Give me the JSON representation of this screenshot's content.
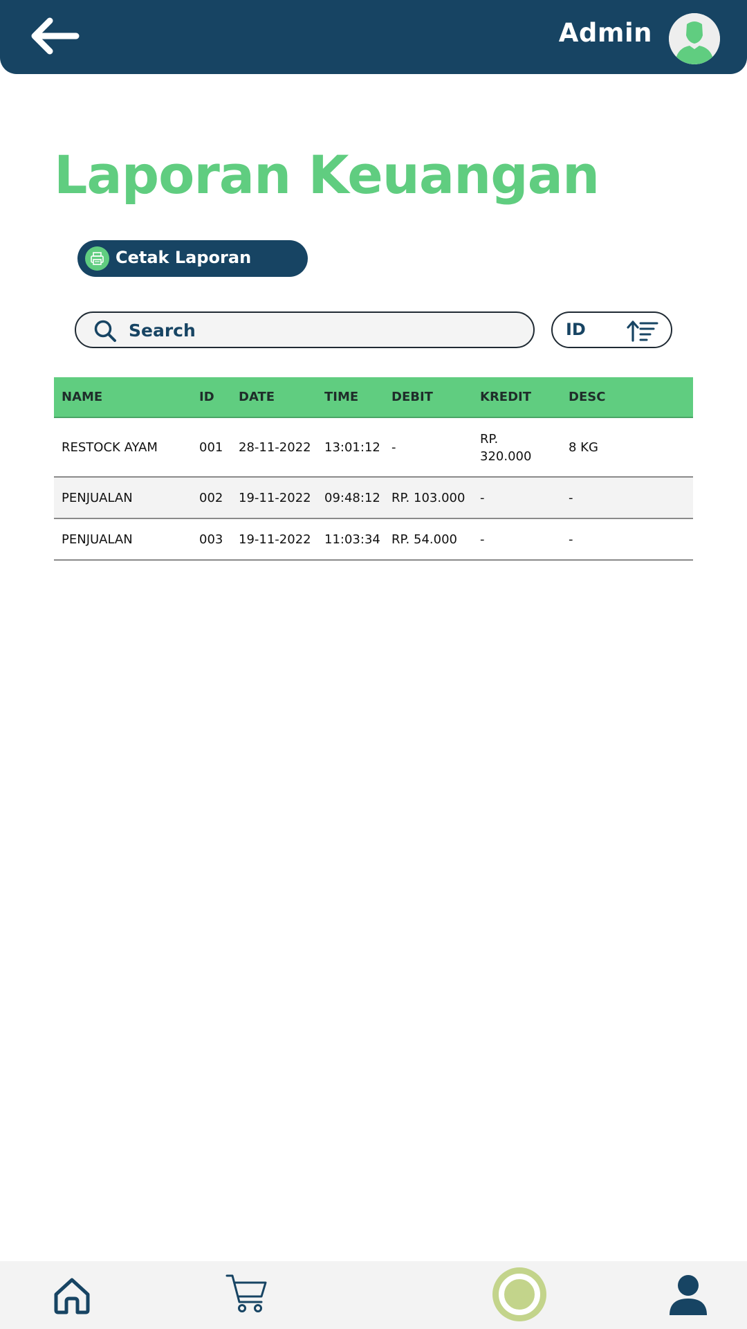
{
  "header": {
    "admin_name": "Admin",
    "colors": {
      "header_bg": "#174463",
      "accent": "#60cd80"
    }
  },
  "page": {
    "title": "Laporan Keuangan"
  },
  "actions": {
    "print_label": "Cetak Laporan"
  },
  "search": {
    "placeholder": "Search",
    "value": ""
  },
  "sort": {
    "label": "ID",
    "icon": "sort-ascending-icon"
  },
  "table": {
    "headers": [
      "NAME",
      "ID",
      "DATE",
      "TIME",
      "DEBIT",
      "KREDIT",
      "DESC"
    ],
    "rows": [
      {
        "name": "RESTOCK AYAM",
        "id": "001",
        "date": "28-11-2022",
        "time": "13:01:12",
        "debit": "-",
        "kredit": "RP. 320.000",
        "desc": "8 KG"
      },
      {
        "name": "PENJUALAN",
        "id": "002",
        "date": "19-11-2022",
        "time": "09:48:12",
        "debit": "RP. 103.000",
        "kredit": "-",
        "desc": "-"
      },
      {
        "name": "PENJUALAN",
        "id": "003",
        "date": "19-11-2022",
        "time": "11:03:34",
        "debit": "RP. 54.000",
        "kredit": "-",
        "desc": "-"
      }
    ]
  },
  "bottom_nav": {
    "items": [
      {
        "icon": "home-icon"
      },
      {
        "icon": "cart-icon"
      },
      {
        "icon": "report-icon",
        "active": true
      },
      {
        "icon": "profile-icon"
      }
    ]
  }
}
